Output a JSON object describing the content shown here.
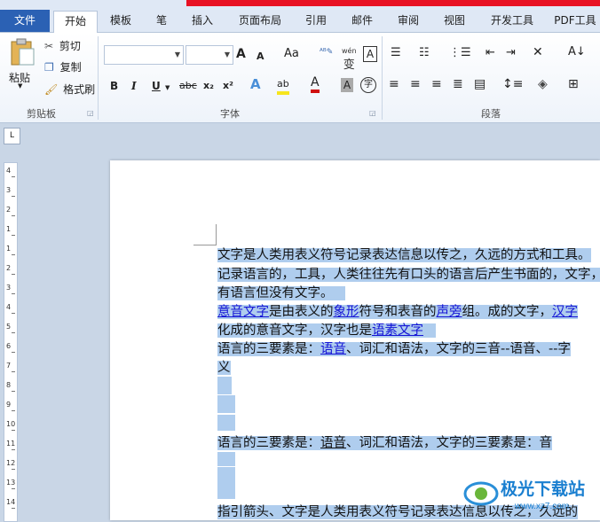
{
  "tabs": [
    "文件",
    "开始",
    "模板",
    "笔",
    "插入",
    "页面布局",
    "引用",
    "邮件",
    "审阅",
    "视图",
    "开发工具",
    "PDF工具"
  ],
  "clipboard": {
    "paste": "粘贴",
    "cut": "剪切",
    "copy": "复制",
    "format_painter": "格式刷",
    "group_label": "剪贴板"
  },
  "font": {
    "group_label": "字体",
    "grow": "A",
    "shrink": "A",
    "aa": "Aa",
    "bold": "B",
    "italic": "I",
    "underline": "U",
    "strike": "abc",
    "subscript": "x₂",
    "superscript": "x²",
    "highlight": "ab",
    "fontcolor": "A",
    "charshade": "A",
    "enclose": "字",
    "wen": "wén",
    "A_box": "A"
  },
  "paragraph": {
    "group_label": "段落"
  },
  "document": {
    "lines": [
      [
        {
          "t": "文字是人类用表义符号记录表达信息以传之，久远的方式和工具。"
        }
      ],
      [
        {
          "t": "记录语言的，工具，人类往往先有口头的语言后产生书面的，文字，很多"
        }
      ],
      [
        {
          "t": "有语言但没有文字。"
        }
      ],
      [
        {
          "t": "意音文字",
          "link": true
        },
        {
          "t": "是由表义的"
        },
        {
          "t": "象形",
          "link": true
        },
        {
          "t": "符号和表音的"
        },
        {
          "t": "声旁",
          "link": true
        },
        {
          "t": "组。成的文字，"
        },
        {
          "t": "汉字",
          "link": true
        }
      ],
      [
        {
          "t": "化成的意音文字，汉字也是"
        },
        {
          "t": "语素文字",
          "link": true
        }
      ],
      [
        {
          "t": "语言的三要素是："
        },
        {
          "t": "语音",
          "link": true
        },
        {
          "t": "、词汇和语法，文字的三音--语音、--字"
        }
      ],
      [
        {
          "t": "义"
        }
      ],
      [
        {
          "t": "语言的三要素是："
        },
        {
          "t": "语音",
          "link": false,
          "u": true
        },
        {
          "t": "、词汇和语法，文字的三要素是：音"
        }
      ],
      [
        {
          "t": "指引箭头、文字是人类用表义符号记录表达信息以传之，久远的"
        }
      ]
    ]
  },
  "watermark": {
    "text": "极光下载站",
    "url": "www.xz7.com"
  },
  "ruler_numbers": [
    "4",
    "3",
    "2",
    "1",
    "1",
    "2",
    "3",
    "4",
    "5",
    "6",
    "7",
    "8",
    "9",
    "10",
    "11",
    "12",
    "13",
    "14"
  ]
}
